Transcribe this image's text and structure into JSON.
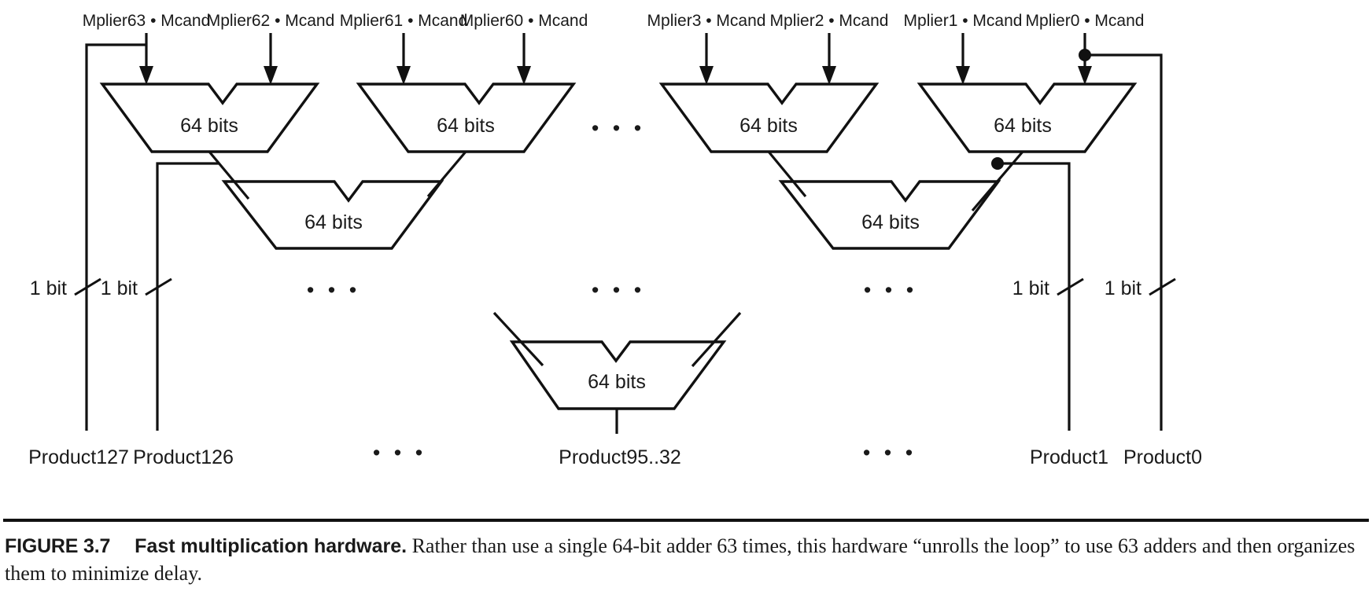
{
  "figure": {
    "number_label": "FIGURE 3.7",
    "title": "Fast multiplication hardware.",
    "body": "Rather than use a single 64-bit adder 63 times, this hardware “unrolls the loop” to use 63 adders and then organizes them to minimize delay."
  },
  "diagram": {
    "inputs": [
      {
        "id": "in63",
        "label": "Mplier63 • Mcand"
      },
      {
        "id": "in62",
        "label": "Mplier62 • Mcand"
      },
      {
        "id": "in61",
        "label": "Mplier61 • Mcand"
      },
      {
        "id": "in60",
        "label": "Mplier60 • Mcand"
      },
      {
        "id": "in3",
        "label": "Mplier3 • Mcand"
      },
      {
        "id": "in2",
        "label": "Mplier2 • Mcand"
      },
      {
        "id": "in1",
        "label": "Mplier1 • Mcand"
      },
      {
        "id": "in0",
        "label": "Mplier0 • Mcand"
      }
    ],
    "adders": [
      {
        "id": "adder-l1-a",
        "label": "64 bits",
        "level": 1
      },
      {
        "id": "adder-l1-b",
        "label": "64 bits",
        "level": 1
      },
      {
        "id": "adder-l1-c",
        "label": "64 bits",
        "level": 1
      },
      {
        "id": "adder-l1-d",
        "label": "64 bits",
        "level": 1
      },
      {
        "id": "adder-l2-a",
        "label": "64 bits",
        "level": 2
      },
      {
        "id": "adder-l2-b",
        "label": "64 bits",
        "level": 2
      },
      {
        "id": "adder-l3",
        "label": "64 bits",
        "level": 3
      }
    ],
    "bit_labels": [
      {
        "id": "bit-p127",
        "label": "1 bit"
      },
      {
        "id": "bit-p126",
        "label": "1 bit"
      },
      {
        "id": "bit-p1",
        "label": "1 bit"
      },
      {
        "id": "bit-p0",
        "label": "1 bit"
      }
    ],
    "outputs": [
      {
        "id": "out-p127",
        "label": "Product127"
      },
      {
        "id": "out-p126",
        "label": "Product126"
      },
      {
        "id": "out-mid",
        "label": "Product95..32"
      },
      {
        "id": "out-p1",
        "label": "Product1"
      },
      {
        "id": "out-p0",
        "label": "Product0"
      }
    ],
    "ellipses": [
      {
        "id": "ellipsis-top-mid",
        "label": "• • •"
      },
      {
        "id": "ellipsis-mid-left",
        "label": "• • •"
      },
      {
        "id": "ellipsis-mid-center",
        "label": "• • •"
      },
      {
        "id": "ellipsis-mid-right",
        "label": "• • •"
      },
      {
        "id": "ellipsis-bottom-left",
        "label": "• • •"
      },
      {
        "id": "ellipsis-bottom-right",
        "label": "• • •"
      }
    ],
    "colors": {
      "line": "#111111",
      "text": "#1a1a1a",
      "background": "#ffffff"
    }
  }
}
